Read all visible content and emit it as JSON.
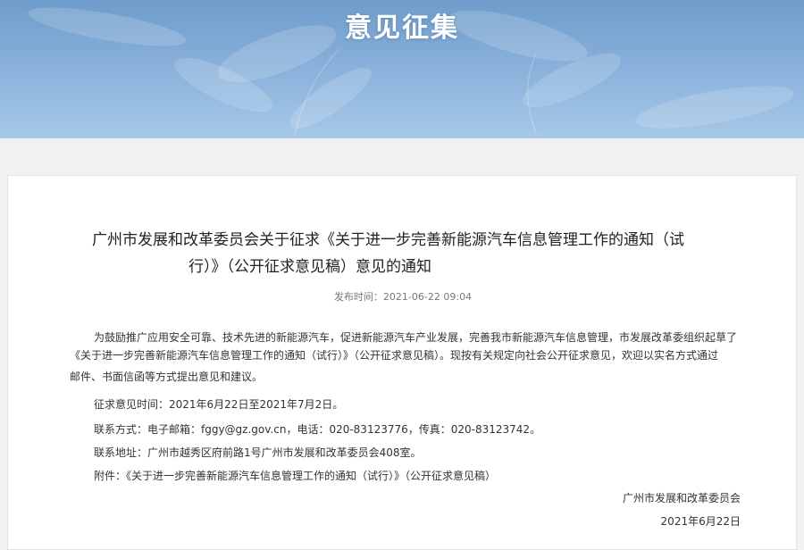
{
  "banner": {
    "title": "意见征集",
    "background_color": "#86afd9"
  },
  "article": {
    "title_line1": "广州市发展和改革委员会关于征求《关于进一步完善新能源汽车信息管理工作的通知（试",
    "title_line2": "行）》（公开征求意见稿）意见的通知",
    "publish_time": "发布时间：2021-06-22 09:04",
    "intro_line1": "为鼓励推广应用安全可靠、技术先进的新能源汽车，促进新能源汽车产业发展，完善我市新能源汽车信息管理，市发展改革委组织起草了",
    "intro_line2": "《关于进一步完善新能源汽车信息管理工作的通知（试行）》（公开征求意见稿）。现按有关规定向社会公开征求意见，欢迎以实名方式通过",
    "intro_line3": "邮件、书面信函等方式提出意见和建议。",
    "period": "征求意见时间：2021年6月22日至2021年7月2日。",
    "contact": "联系方式：电子邮箱：fggy@gz.gov.cn，电话：020-83123776，传真：020-83123742。",
    "address": "联系地址：广州市越秀区府前路1号广州市发展和改革委员会408室。",
    "attachment_label": "附件：",
    "attachment_link": "《关于进一步完善新能源汽车信息管理工作的通知（试行）》（公开征求意见稿）",
    "signature_org": "广州市发展和改革委员会",
    "signature_date": "2021年6月22日"
  }
}
